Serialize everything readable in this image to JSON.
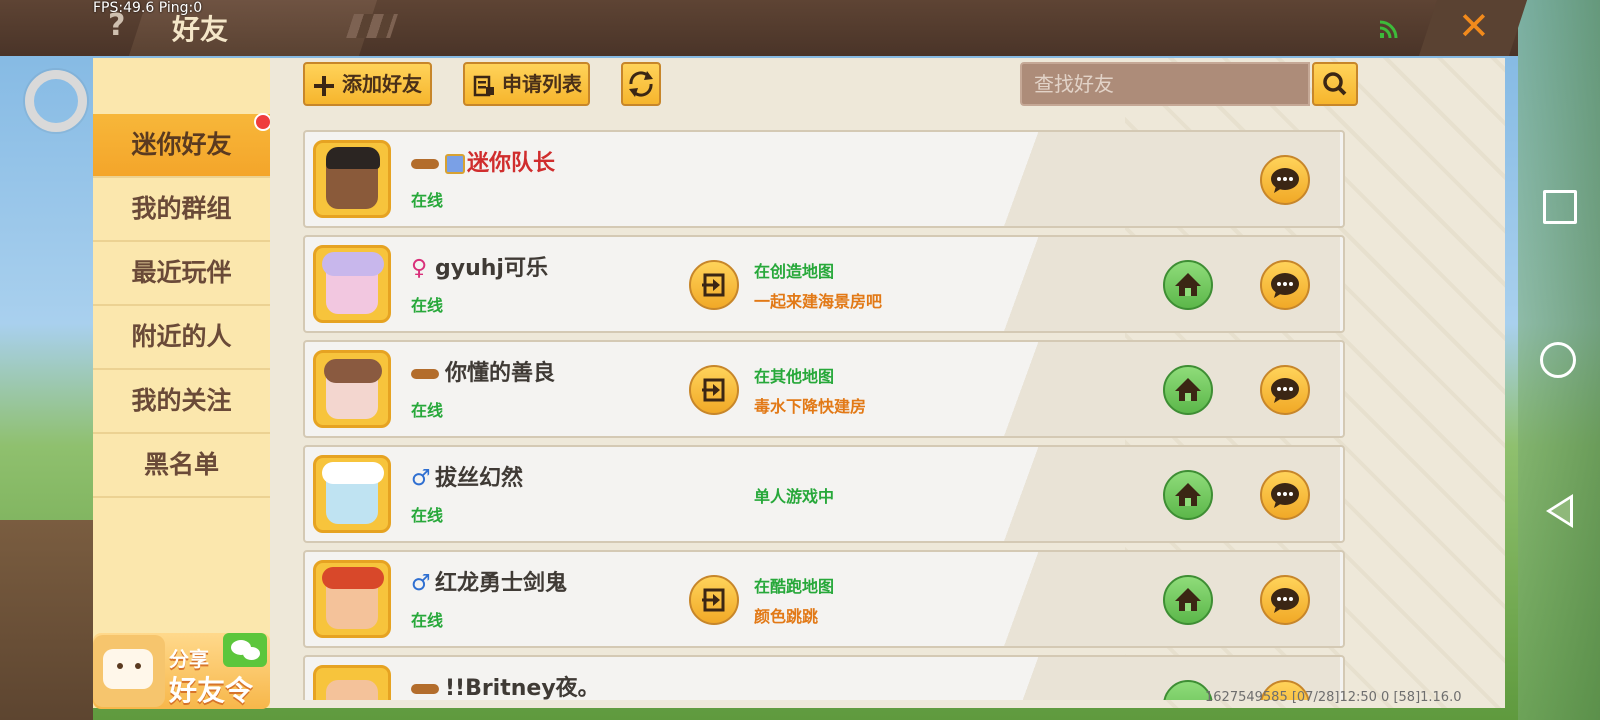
{
  "overlay": {
    "fps": "FPS:49.6  Ping:0",
    "build_info": "1627549585   [07/28]12:50 0  [58]1.16.0"
  },
  "header": {
    "help_icon": "?",
    "title": "好友",
    "close_icon": "✕"
  },
  "sidebar": {
    "items": [
      {
        "label": "迷你好友",
        "active": true
      },
      {
        "label": "我的群组"
      },
      {
        "label": "最近玩伴"
      },
      {
        "label": "附近的人"
      },
      {
        "label": "我的关注"
      },
      {
        "label": "黑名单"
      }
    ],
    "share": {
      "label": "分享",
      "title": "好友令"
    }
  },
  "toolbar": {
    "add_friend": "添加好友",
    "apply_list": "申请列表",
    "search_placeholder": "查找好友"
  },
  "friends": [
    {
      "name": "迷你队长",
      "online": "在线",
      "badge": "mask",
      "vip": true,
      "name_color": "#d02d2d"
    },
    {
      "name": "gyuhj可乐",
      "online": "在线",
      "gender": "♀",
      "gender_color": "#d9307a",
      "status1": "在创造地图",
      "status2": "一起来建海景房吧"
    },
    {
      "name": "你懂的善良",
      "online": "在线",
      "badge": "mask",
      "status1": "在其他地图",
      "status2": "毒水下降快建房"
    },
    {
      "name": "拔丝幻然",
      "online": "在线",
      "gender": "♂",
      "gender_color": "#2f6fd1",
      "status1": "单人游戏中"
    },
    {
      "name": "红龙勇士剑鬼",
      "online": "在线",
      "gender": "♂",
      "gender_color": "#2f6fd1",
      "status1": "在酷跑地图",
      "status2": "颜色跳跳"
    },
    {
      "name": "!!Britney夜。",
      "online": "",
      "badge": "mask"
    }
  ],
  "icons": {
    "enter": "enter-icon",
    "home": "home-icon",
    "chat": "chat-icon",
    "refresh": "refresh-icon",
    "search": "search-icon"
  },
  "colors": {
    "accent": "#f6b52d",
    "online": "#27a83a",
    "status_sub": "#e27916",
    "header_bg": "#4a3428"
  }
}
